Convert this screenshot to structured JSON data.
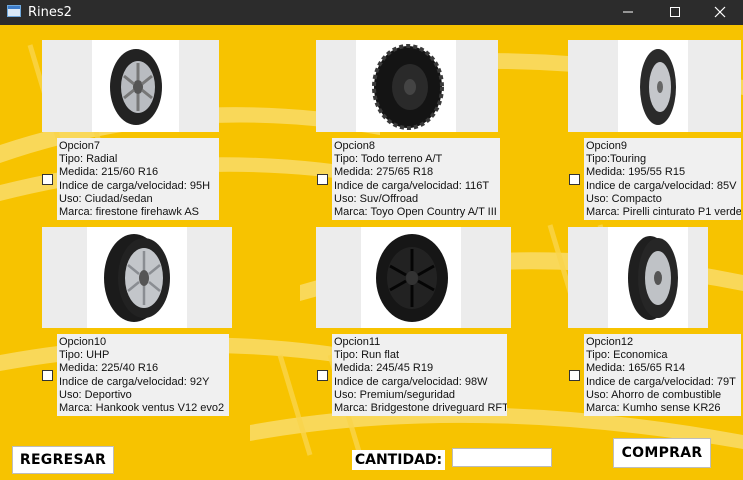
{
  "window": {
    "title": "Rines2",
    "min_icon": "minimize-icon",
    "max_icon": "maximize-icon",
    "close_icon": "close-icon"
  },
  "products": [
    {
      "title": "Opcion7",
      "tipo": "Tipo: Radial",
      "medida": "Medida: 215/60 R16",
      "indice": "Indice de carga/velocidad: 95H",
      "uso": "Uso: Ciudad/sedan",
      "marca": "Marca: firestone firehawk AS"
    },
    {
      "title": "Opcion8",
      "tipo": "Tipo: Todo terreno A/T",
      "medida": "Medida: 275/65 R18",
      "indice": "Indice de carga/velocidad: 116T",
      "uso": "Uso: Suv/Offroad",
      "marca": "Marca: Toyo Open Country A/T III"
    },
    {
      "title": "Opcion9",
      "tipo": "Tipo:Touring",
      "medida": "Medida: 195/55 R15",
      "indice": "Indice de carga/velocidad: 85V",
      "uso": "Uso: Compacto",
      "marca": "Marca: Pirelli cinturato P1 verde"
    },
    {
      "title": "Opcion10",
      "tipo": "Tipo: UHP",
      "medida": "Medida: 225/40 R16",
      "indice": "Indice de carga/velocidad: 92Y",
      "uso": "Uso: Deportivo",
      "marca": "Marca: Hankook ventus V12 evo2"
    },
    {
      "title": "Opcion11",
      "tipo": "Tipo: Run flat",
      "medida": "Medida: 245/45 R19",
      "indice": "Indice de carga/velocidad: 98W",
      "uso": "Uso: Premium/seguridad",
      "marca": "Marca: Bridgestone driveguard RFT"
    },
    {
      "title": "Opcion12",
      "tipo": "Tipo: Economica",
      "medida": "Medida: 165/65 R14",
      "indice": "Indice de carga/velocidad: 79T",
      "uso": "Uso: Ahorro de combustible",
      "marca": "Marca: Kumho sense KR26"
    }
  ],
  "buttons": {
    "regresar": "REGRESAR",
    "comprar": "COMPRAR"
  },
  "cantidad": {
    "label": "CANTIDAD:",
    "value": ""
  },
  "colors": {
    "background": "#f7c300",
    "titlebar": "#2c2c2c"
  }
}
